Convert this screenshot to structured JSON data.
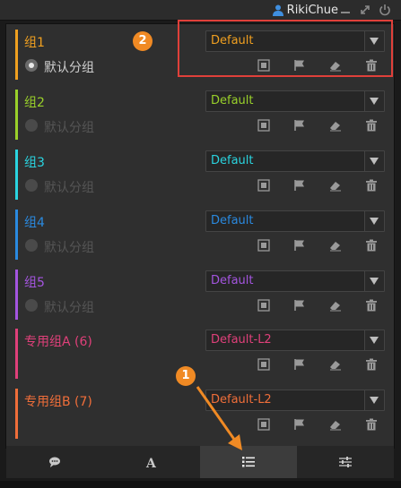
{
  "topbar": {
    "username": "RikiChue"
  },
  "groups": [
    {
      "name": "组1",
      "color": "#f0a020",
      "sub": "默认分组",
      "sub_state": "active",
      "select": "Default"
    },
    {
      "name": "组2",
      "color": "#9ad12a",
      "sub": "默认分组",
      "sub_state": "disabled",
      "select": "Default"
    },
    {
      "name": "组3",
      "color": "#2ad4e0",
      "sub": "默认分组",
      "sub_state": "disabled",
      "select": "Default"
    },
    {
      "name": "组4",
      "color": "#2a8ae0",
      "sub": "默认分组",
      "sub_state": "disabled",
      "select": "Default"
    },
    {
      "name": "组5",
      "color": "#a455e0",
      "sub": "默认分组",
      "sub_state": "disabled",
      "select": "Default"
    },
    {
      "name": "专用组A (6)",
      "color": "#e0407a",
      "sub": "",
      "sub_state": "none",
      "select": "Default-L2"
    },
    {
      "name": "专用组B (7)",
      "color": "#f06e3a",
      "sub": "",
      "sub_state": "none",
      "select": "Default-L2"
    }
  ],
  "action_icons": [
    "screenshot-icon",
    "flag-icon",
    "eraser-icon",
    "trash-icon"
  ],
  "tabs": [
    {
      "name": "chat-icon",
      "selected": false
    },
    {
      "name": "font-icon",
      "selected": false
    },
    {
      "name": "list-icon",
      "selected": true
    },
    {
      "name": "sliders-icon",
      "selected": false
    }
  ],
  "markers": {
    "one": "1",
    "two": "2"
  }
}
